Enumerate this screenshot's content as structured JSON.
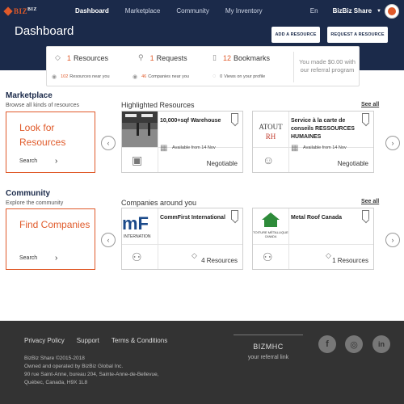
{
  "nav": {
    "logo": "BIZBIZ",
    "links": [
      "Dashboard",
      "Marketplace",
      "Community",
      "My Inventory"
    ],
    "lang": "En",
    "account": "BizBiz Share"
  },
  "header": {
    "title": "Dashboard",
    "add_resource": "ADD A RESOURCE",
    "request_resource": "REQUEST A RESOURCE"
  },
  "stats": {
    "resources_num": "1",
    "resources_label": "Resources",
    "requests_num": "1",
    "requests_label": "Requests",
    "bookmarks_num": "12",
    "bookmarks_label": "Bookmarks",
    "near_resources_num": "102",
    "near_resources_label": "Resources near you",
    "near_companies_num": "46",
    "near_companies_label": "Companies near you",
    "views_num": "0",
    "views_label": "Views on your profile",
    "referral": "You made $0.00 with our referral program"
  },
  "marketplace": {
    "title": "Marketplace",
    "subtitle": "Browse all kinds of resources",
    "action_title": "Look for Resources",
    "action_search": "Search",
    "list_title": "Highlighted Resources",
    "see_all": "See all",
    "cards": [
      {
        "title": "10,000+sqf Warehouse",
        "date": "Available from 14 Nov",
        "price": "Negotiable"
      },
      {
        "title": "Service à la carte de conseils RESSOURCES HUMAINES",
        "logo": "ATOUT RH",
        "date": "Available from 14 Nov",
        "price": "Negotiable"
      }
    ]
  },
  "community": {
    "title": "Community",
    "subtitle": "Explore the community",
    "action_title": "Find Companies",
    "action_search": "Search",
    "list_title": "Companies around you",
    "see_all": "See all",
    "cards": [
      {
        "title": "CommFirst International",
        "logo": "mF INTERNATIONAL",
        "count": "4 Resources"
      },
      {
        "title": "Metal Roof Canada",
        "logo": "TOITURE MÉTALLIQUE CANADA",
        "count": "1 Resources"
      }
    ]
  },
  "footer": {
    "links": [
      "Privacy Policy",
      "Support",
      "Terms & Conditions"
    ],
    "copyright": "BizBiz Share ©2015-2018",
    "operated": "Owned and operated by BizBiz Global Inc.",
    "address": "90 rue Saint-Anne, bureau 204, Sainte-Anne-de-Bellevue, Québec, Canada, H9X 1L8",
    "ref_code": "BIZMHC",
    "ref_label": "your referral link",
    "social": [
      "f",
      "◎",
      "in"
    ]
  },
  "colors": {
    "navy": "#1b2a4a",
    "accent": "#e05a2a",
    "footer": "#333333"
  }
}
